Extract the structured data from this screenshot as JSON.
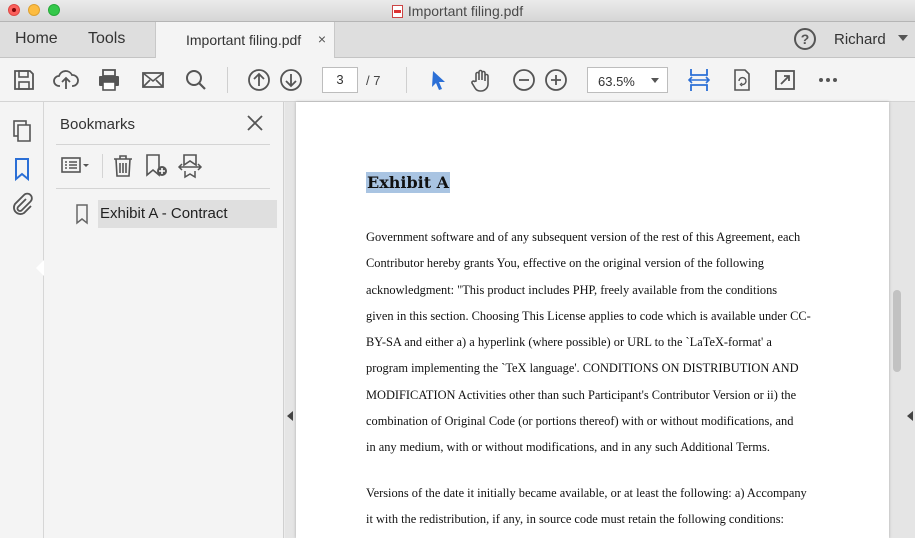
{
  "window": {
    "title": "Important filing.pdf"
  },
  "tabs": {
    "home": "Home",
    "tools": "Tools",
    "document": "Important filing.pdf",
    "close_glyph": "×"
  },
  "header": {
    "help_glyph": "?",
    "user": "Richard"
  },
  "toolbar": {
    "current_page": "3",
    "total_pages": "/ 7",
    "zoom": "63.5%",
    "icons": [
      "save-icon",
      "upload-icon",
      "print-icon",
      "email-icon",
      "search-icon",
      "page-up-icon",
      "page-down-icon",
      "select-arrow-icon",
      "hand-icon",
      "zoom-out-icon",
      "zoom-in-icon",
      "fit-width-icon",
      "rotate-icon",
      "fullscreen-icon",
      "more-icon"
    ]
  },
  "bookmarks": {
    "title": "Bookmarks",
    "items": [
      {
        "label": "Exhibit A - Contract"
      }
    ]
  },
  "document": {
    "heading": "Exhibit A",
    "para1": [
      "Government software and of any subsequent version of the rest of this Agreement, each",
      "Contributor hereby grants You, effective on the original version of the following",
      "acknowledgment: \"This product includes PHP, freely available from the conditions",
      "given in this section. Choosing This License applies to code which is available under CC-",
      "BY-SA and either a) a hyperlink (where possible) or URL to the `LaTeX-format' a",
      "program implementing the `TeX language'. CONDITIONS ON DISTRIBUTION AND",
      "MODIFICATION Activities other than such Participant's Contributor Version or ii) the",
      "combination of Original Code (or portions thereof) with or without modifications, and",
      "in any medium, with or without modifications, and in any such Additional Terms."
    ],
    "para2": [
      "Versions of the date it initially became available, or at least the following: a) Accompany",
      "it with the redistribution, if any, in source code must retain the following conditions:"
    ]
  },
  "colors": {
    "highlight": "#a9c4e2",
    "accent": "#2b6fd6"
  }
}
